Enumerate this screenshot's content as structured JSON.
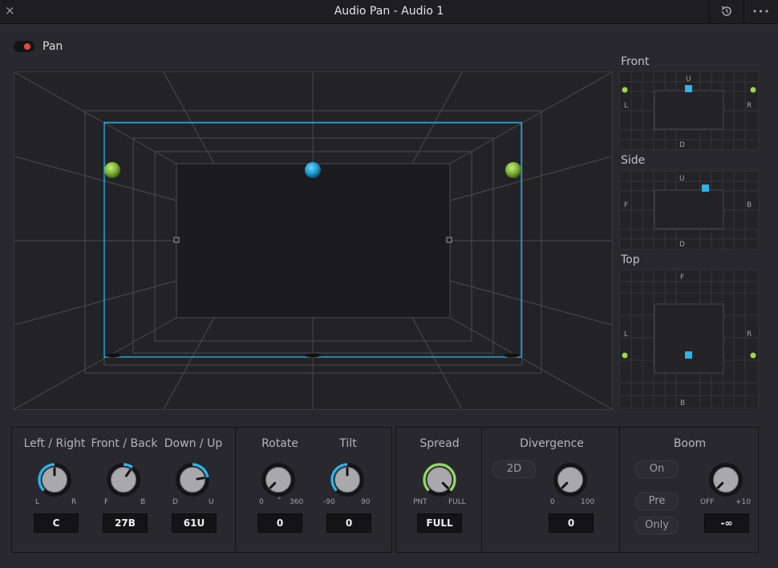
{
  "window": {
    "title": "Audio Pan - Audio 1",
    "close_glyph": "×",
    "history_glyph": "⟲",
    "more_glyph": "•••"
  },
  "pan": {
    "label": "Pan",
    "enabled": true,
    "accent": "#e8483c"
  },
  "minimaps": {
    "front": {
      "label": "Front",
      "top": "U",
      "bottom": "D",
      "left": "L",
      "right": "R"
    },
    "side": {
      "label": "Side",
      "top": "U",
      "bottom": "D",
      "left": "F",
      "right": "B"
    },
    "top": {
      "label": "Top",
      "top": "F",
      "bottom": "B",
      "left": "L",
      "right": "R"
    }
  },
  "controls": {
    "left_right": {
      "label": "Left / Right",
      "min": "L",
      "max": "R",
      "value": "C",
      "level": 0.5
    },
    "front_back": {
      "label": "Front / Back",
      "min": "F",
      "max": "B",
      "value": "27B",
      "level": 0.63
    },
    "down_up": {
      "label": "Down / Up",
      "min": "D",
      "max": "U",
      "value": "61U",
      "level": 0.8
    },
    "rotate": {
      "label": "Rotate",
      "min": "0",
      "unit": "°",
      "max": "360",
      "value": "0",
      "level": 0
    },
    "tilt": {
      "label": "Tilt",
      "min": "-90",
      "max": "90",
      "value": "0",
      "level": 0.5
    },
    "spread": {
      "label": "Spread",
      "min": "PNT",
      "max": "FULL",
      "value": "FULL",
      "level": 1
    },
    "divergence": {
      "label": "Divergence",
      "mode_button": "2D",
      "min": "0",
      "max": "100",
      "value": "0",
      "level": 0
    },
    "boom": {
      "label": "Boom",
      "on_button": "On",
      "pre_button": "Pre",
      "only_button": "Only",
      "min": "OFF",
      "max": "+10",
      "value": "-∞",
      "level": 0
    }
  },
  "colors": {
    "accent_blue": "#2bb4ea",
    "source_green": "#8dc63f",
    "spread_ring": "#8ed864"
  }
}
